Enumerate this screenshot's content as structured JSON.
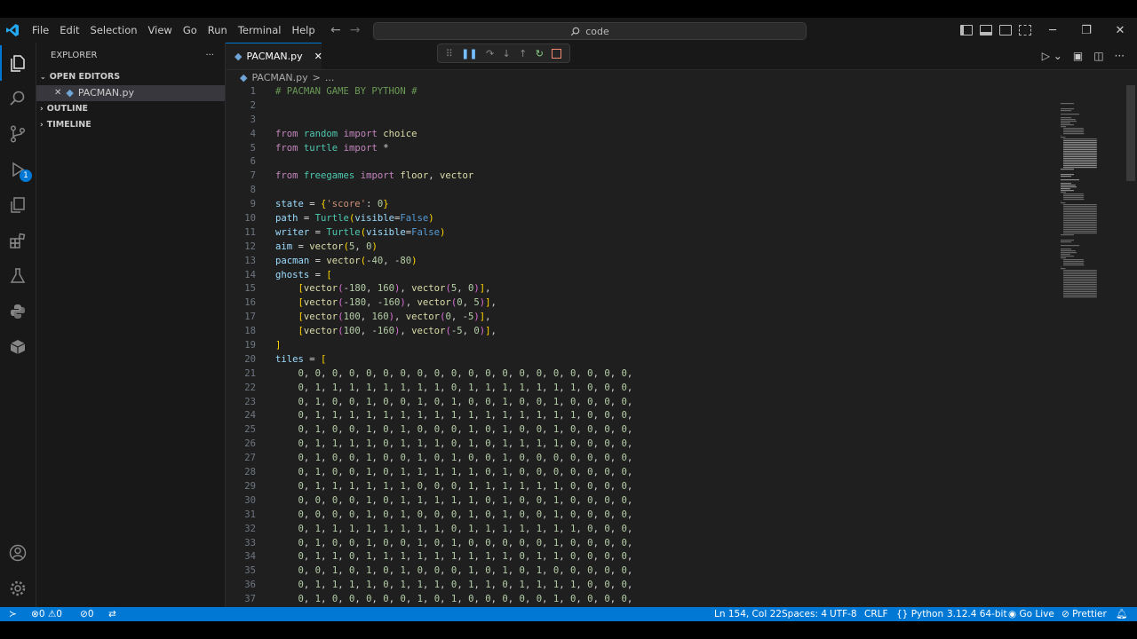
{
  "menu": [
    "File",
    "Edit",
    "Selection",
    "View",
    "Go",
    "Run",
    "Terminal",
    "Help"
  ],
  "command_center": {
    "label": "code"
  },
  "sidebar": {
    "title": "EXPLORER",
    "more": "···",
    "sections": {
      "open_editors": "OPEN EDITORS",
      "outline": "OUTLINE",
      "timeline": "TIMELINE"
    },
    "open_file": "PACMAN.py"
  },
  "activity_badge": "1",
  "tab": {
    "label": "PACMAN.py"
  },
  "breadcrumb": {
    "file": "PACMAN.py",
    "sep": ">",
    "rest": "..."
  },
  "code_lines": [
    {
      "n": "1",
      "t": "# PACMAN GAME BY PYTHON #"
    },
    {
      "n": "2",
      "t": ""
    },
    {
      "n": "3",
      "t": ""
    },
    {
      "n": "4",
      "t": "from random import choice"
    },
    {
      "n": "5",
      "t": "from turtle import *"
    },
    {
      "n": "6",
      "t": ""
    },
    {
      "n": "7",
      "t": "from freegames import floor, vector"
    },
    {
      "n": "8",
      "t": ""
    },
    {
      "n": "9",
      "t": "state = {'score': 0}"
    },
    {
      "n": "10",
      "t": "path = Turtle(visible=False)"
    },
    {
      "n": "11",
      "t": "writer = Turtle(visible=False)"
    },
    {
      "n": "12",
      "t": "aim = vector(5, 0)"
    },
    {
      "n": "13",
      "t": "pacman = vector(-40, -80)"
    },
    {
      "n": "14",
      "t": "ghosts = ["
    },
    {
      "n": "15",
      "t": "    [vector(-180, 160), vector(5, 0)],"
    },
    {
      "n": "16",
      "t": "    [vector(-180, -160), vector(0, 5)],"
    },
    {
      "n": "17",
      "t": "    [vector(100, 160), vector(0, -5)],"
    },
    {
      "n": "18",
      "t": "    [vector(100, -160), vector(-5, 0)],"
    },
    {
      "n": "19",
      "t": "]"
    },
    {
      "n": "20",
      "t": "tiles = ["
    },
    {
      "n": "21",
      "t": "    0, 0, 0, 0, 0, 0, 0, 0, 0, 0, 0, 0, 0, 0, 0, 0, 0, 0, 0, 0,"
    },
    {
      "n": "22",
      "t": "    0, 1, 1, 1, 1, 1, 1, 1, 1, 0, 1, 1, 1, 1, 1, 1, 1, 0, 0, 0,"
    },
    {
      "n": "23",
      "t": "    0, 1, 0, 0, 1, 0, 0, 1, 0, 1, 0, 0, 1, 0, 0, 1, 0, 0, 0, 0,"
    },
    {
      "n": "24",
      "t": "    0, 1, 1, 1, 1, 1, 1, 1, 1, 1, 1, 1, 1, 1, 1, 1, 1, 0, 0, 0,"
    },
    {
      "n": "25",
      "t": "    0, 1, 0, 0, 1, 0, 1, 0, 0, 0, 1, 0, 1, 0, 0, 1, 0, 0, 0, 0,"
    },
    {
      "n": "26",
      "t": "    0, 1, 1, 1, 1, 0, 1, 1, 1, 0, 1, 0, 1, 1, 1, 1, 0, 0, 0, 0,"
    },
    {
      "n": "27",
      "t": "    0, 1, 0, 0, 1, 0, 0, 1, 0, 1, 0, 0, 1, 0, 0, 0, 0, 0, 0, 0,"
    },
    {
      "n": "28",
      "t": "    0, 1, 0, 0, 1, 0, 1, 1, 1, 1, 1, 0, 1, 0, 0, 0, 0, 0, 0, 0,"
    },
    {
      "n": "29",
      "t": "    0, 1, 1, 1, 1, 1, 1, 0, 0, 0, 1, 1, 1, 1, 1, 1, 0, 0, 0, 0,"
    },
    {
      "n": "30",
      "t": "    0, 0, 0, 0, 1, 0, 1, 1, 1, 1, 1, 0, 1, 0, 0, 1, 0, 0, 0, 0,"
    },
    {
      "n": "31",
      "t": "    0, 0, 0, 0, 1, 0, 1, 0, 0, 0, 1, 0, 1, 0, 0, 1, 0, 0, 0, 0,"
    },
    {
      "n": "32",
      "t": "    0, 1, 1, 1, 1, 1, 1, 1, 1, 0, 1, 1, 1, 1, 1, 1, 1, 0, 0, 0,"
    },
    {
      "n": "33",
      "t": "    0, 1, 0, 0, 1, 0, 0, 1, 0, 1, 0, 0, 0, 0, 0, 1, 0, 0, 0, 0,"
    },
    {
      "n": "34",
      "t": "    0, 1, 1, 0, 1, 1, 1, 1, 1, 1, 1, 1, 1, 0, 1, 1, 0, 0, 0, 0,"
    },
    {
      "n": "35",
      "t": "    0, 0, 1, 0, 1, 0, 1, 0, 0, 0, 1, 0, 1, 0, 1, 0, 0, 0, 0, 0,"
    },
    {
      "n": "36",
      "t": "    0, 1, 1, 1, 1, 0, 1, 1, 1, 0, 1, 1, 0, 1, 1, 1, 1, 0, 0, 0,"
    },
    {
      "n": "37",
      "t": "    0, 1, 0, 0, 0, 0, 0, 1, 0, 1, 0, 0, 0, 0, 0, 1, 0, 0, 0, 0,"
    }
  ],
  "status": {
    "errors": "0",
    "warnings": "0",
    "ports": "0",
    "position": "Ln 154, Col 22",
    "spaces": "Spaces: 4",
    "encoding": "UTF-8",
    "eol": "CRLF",
    "language": "Python",
    "interpreter": "3.12.4 64-bit",
    "golive": "Go Live",
    "prettier": "Prettier"
  },
  "colors": {
    "accent": "#0078d4",
    "keyword": "#c586c0",
    "string": "#ce9178",
    "number": "#b5cea8",
    "comment": "#6a9955",
    "function": "#dcdcaa",
    "variable": "#9cdcfe",
    "class": "#4ec9b0",
    "constant": "#569cd6"
  }
}
